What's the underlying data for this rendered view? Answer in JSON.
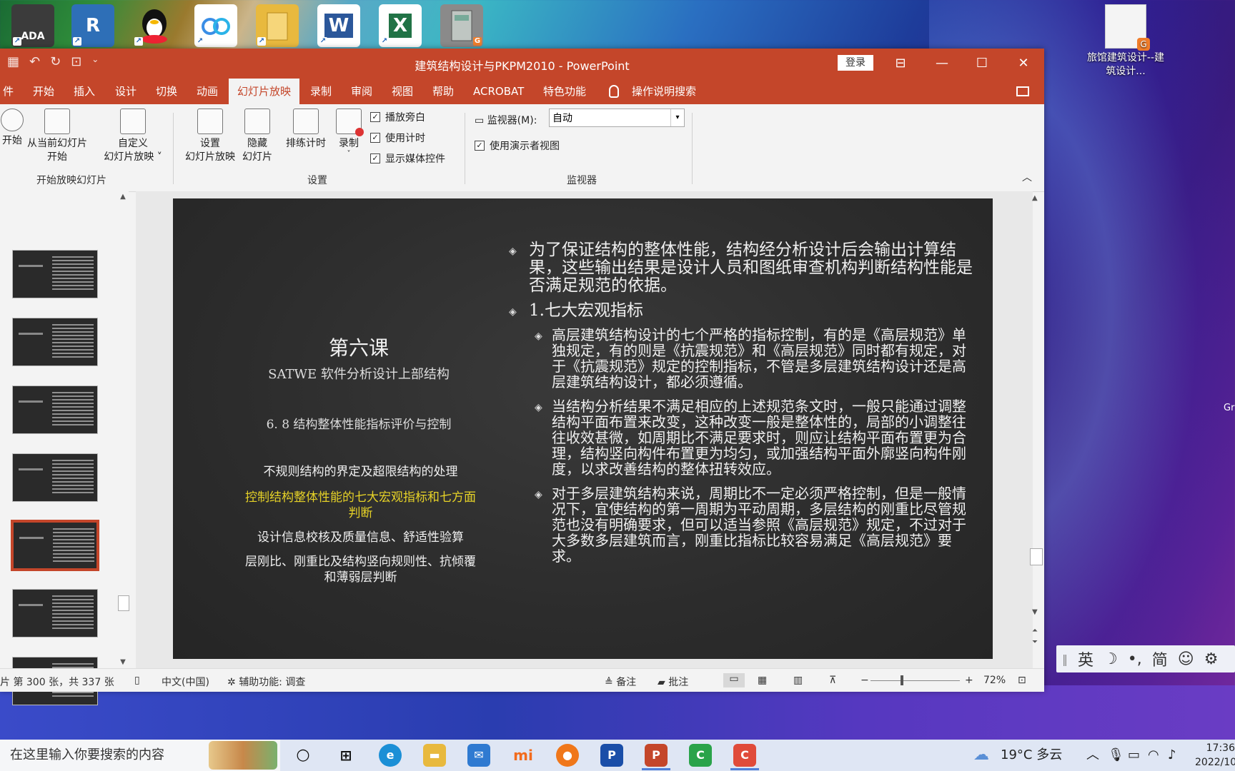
{
  "desktop": {
    "icons": [
      {
        "label": "ADA",
        "name": "autocad-ada-icon",
        "color": "#3b3b3b"
      },
      {
        "label": "R",
        "name": "revit-icon",
        "color": "#2e6fb7"
      },
      {
        "label": "QQ",
        "name": "qq-icon",
        "color": "#1a1a1a"
      },
      {
        "label": "☁",
        "name": "baidu-netdisk-icon",
        "color": "#3a8ee6"
      },
      {
        "label": "📁",
        "name": "folder-icon",
        "color": "#e8b93e"
      },
      {
        "label": "W",
        "name": "word-icon",
        "color": "#2b579a"
      },
      {
        "label": "X",
        "name": "excel-icon",
        "color": "#217346"
      },
      {
        "label": "▤",
        "name": "software-icon",
        "color": "#8a8a8a"
      }
    ],
    "right_icon_label": "旅馆建筑设计--建筑设计...",
    "right_partial_label": "Gr"
  },
  "window": {
    "title": "建筑结构设计与PKPM2010  -  PowerPoint",
    "login": "登录",
    "controls": {
      "restore_ribbon": "⊟",
      "minimize": "—",
      "maximize": "☐",
      "close": "✕"
    }
  },
  "tabs": [
    {
      "label": "件",
      "active": false
    },
    {
      "label": "开始",
      "active": false
    },
    {
      "label": "插入",
      "active": false
    },
    {
      "label": "设计",
      "active": false
    },
    {
      "label": "切换",
      "active": false
    },
    {
      "label": "动画",
      "active": false
    },
    {
      "label": "幻灯片放映",
      "active": true
    },
    {
      "label": "录制",
      "active": false
    },
    {
      "label": "审阅",
      "active": false
    },
    {
      "label": "视图",
      "active": false
    },
    {
      "label": "帮助",
      "active": false
    },
    {
      "label": "ACROBAT",
      "active": false
    },
    {
      "label": "特色功能",
      "active": false
    }
  ],
  "tell_me": "操作说明搜索",
  "ribbon": {
    "start_group": {
      "name": "开始放映幻灯片",
      "btn_from_start": "开始",
      "btn_from_current_1": "从当前幻灯片",
      "btn_from_current_2": "开始",
      "btn_custom_1": "自定义",
      "btn_custom_2": "幻灯片放映 ˅"
    },
    "setup_group": {
      "name": "设置",
      "btn_setup_1": "设置",
      "btn_setup_2": "幻灯片放映",
      "btn_hide_1": "隐藏",
      "btn_hide_2": "幻灯片",
      "btn_rehearse": "排练计时",
      "btn_record": "录制",
      "btn_record_arrow": "˅",
      "chk_narration": "播放旁白",
      "chk_timings": "使用计时",
      "chk_media": "显示媒体控件"
    },
    "monitor_group": {
      "name": "监视器",
      "monitor_label": "监视器(M):",
      "monitor_value": "自动",
      "chk_presenter": "使用演示者视图"
    }
  },
  "slide": {
    "lesson": "第六课",
    "subtitle": "SATWE 软件分析设计上部结构",
    "section": "6. 8 结构整体性能指标评价与控制",
    "topics": [
      {
        "text": "不规则结构的界定及超限结构的处理",
        "highlight": false
      },
      {
        "text": "控制结构整体性能的七大宏观指标和七方面判断",
        "highlight": true
      },
      {
        "text": "设计信息校核及质量信息、舒适性验算",
        "highlight": false
      },
      {
        "text": "层刚比、刚重比及结构竖向规则性、抗倾覆和薄弱层判断",
        "highlight": false
      }
    ],
    "bullet_1": "为了保证结构的整体性能，结构经分析设计后会输出计算结果，这些输出结果是设计人员和图纸审查机构判断结构性能是否满足规范的依据。",
    "bullet_2": "1.七大宏观指标",
    "sub_1": "高层建筑结构设计的七个严格的指标控制，有的是《高层规范》单独规定，有的则是《抗震规范》和《高层规范》同时都有规定，对于《抗震规范》规定的控制指标，不管是多层建筑结构设计还是高层建筑结构设计，都必须遵循。",
    "sub_2": "当结构分析结果不满足相应的上述规范条文时，一般只能通过调整结构平面布置来改变，这种改变一般是整体性的，局部的小调整往往收效甚微，如周期比不满足要求时，则应让结构平面布置更为合理，结构竖向构件布置更为均匀，或加强结构平面外廓竖向构件刚度，以求改善结构的整体扭转效应。",
    "sub_3": "对于多层建筑结构来说，周期比不一定必须严格控制，但是一般情况下，宜使结构的第一周期为平动周期，多层结构的刚重比尽管规范也没有明确要求，但可以适当参照《高层规范》规定，不过对于大多数多层建筑而言，刚重比指标比较容易满足《高层规范》要求。"
  },
  "status": {
    "slide_info": "片 第 300 张，共 337 张",
    "language": "中文(中国)",
    "accessibility": "辅助功能: 调查",
    "notes": "备注",
    "comments": "批注",
    "zoom_minus": "−",
    "zoom_plus": "+",
    "zoom": "72%"
  },
  "ime": {
    "lang": "英",
    "moon": "☽",
    "punct": "•,",
    "simp": "简",
    "emoji": "☺",
    "gear": "⚙"
  },
  "taskbar": {
    "search_placeholder": "在这里输入你要搜索的内容",
    "weather": "19°C  多云",
    "time": "17:36",
    "date": "2022/10"
  }
}
